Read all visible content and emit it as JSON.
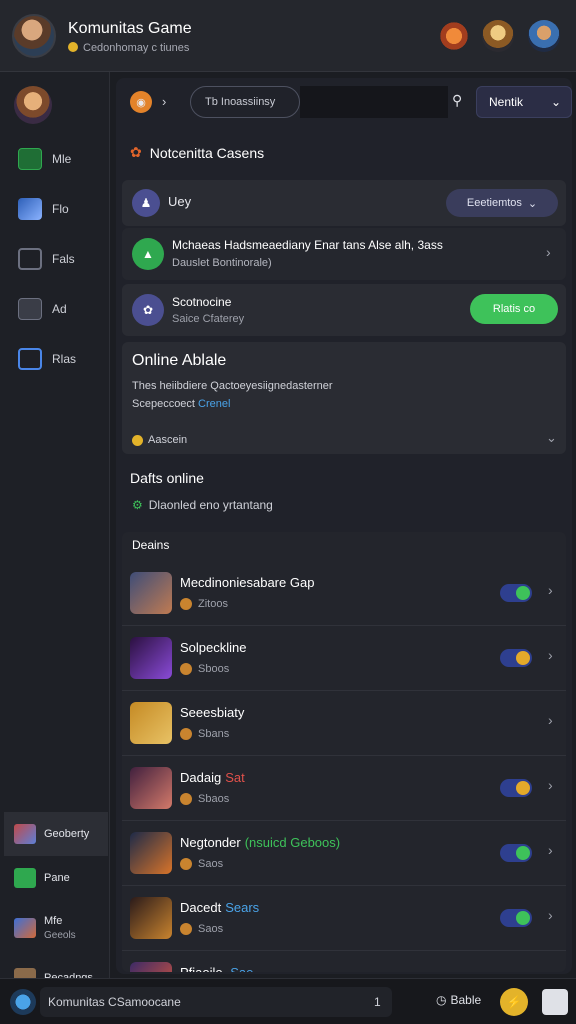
{
  "header": {
    "title": "Komunitas Game",
    "subtitle": "Cedonhomay c tiunes"
  },
  "sidebar": {
    "items": [
      {
        "label": "Mle",
        "color": "#2fa84f"
      },
      {
        "label": "Flo",
        "color": "#3d6fd6"
      },
      {
        "label": "Fals",
        "color": "#6c7080"
      },
      {
        "label": "Ad",
        "color": "#6c7080"
      },
      {
        "label": "Rlas",
        "color": "#4a86e8"
      }
    ],
    "bottom": [
      {
        "label": "Geoberty"
      },
      {
        "label": "Pane"
      },
      {
        "label": "Mfe",
        "sub": "Geeols"
      },
      {
        "label": "Pecadngs"
      }
    ]
  },
  "toolbar": {
    "path_label": "Tb Inoassiinsy",
    "filter_label": "Nentik"
  },
  "notifications": {
    "title": "Notcenitta Casens"
  },
  "cards": {
    "user": {
      "label": "Uey",
      "badge": "Eeetiemtos"
    },
    "banner": {
      "title": "Mchaeas Hadsmeaediany Enar tans Alse alh, 3ass",
      "subtitle": "Dauslet Bontinorale)"
    },
    "session": {
      "title": "Scotnocine",
      "subtitle": "Saice Cfaterey",
      "button": "Rlatis co"
    },
    "online": {
      "title": "Online Ablale",
      "desc": "Thes heiibdiere  Qactoeyesiignedasterner",
      "desc2": "Scepeccoect",
      "link": "Crenel",
      "footer": "Aascein"
    }
  },
  "friends_online": {
    "title": "Dafts online",
    "status": "Dlaonled eno yrtantang"
  },
  "games": {
    "title": "Deains",
    "rows": [
      {
        "name": "Mecdinoniesabare Gap",
        "status": "Zitoos",
        "tag": "",
        "tag_color": "",
        "toggle": true,
        "knob": "#3ec25a",
        "thumb": [
          "#3e4d78",
          "#c07b52"
        ]
      },
      {
        "name": "Solpeckline",
        "status": "Sboos",
        "tag": "",
        "tag_color": "",
        "toggle": true,
        "knob": "#e3a92a",
        "thumb": [
          "#2b1040",
          "#8a4bd8"
        ]
      },
      {
        "name": "Seeesbiaty",
        "status": "Sbans",
        "tag": "",
        "tag_color": "",
        "toggle": false,
        "knob": "",
        "thumb": [
          "#c58a24",
          "#e8c265"
        ]
      },
      {
        "name": "Dadaig",
        "status": "Sbaos",
        "tag": "Sat",
        "tag_color": "#e0514b",
        "toggle": true,
        "knob": "#e3a92a",
        "thumb": [
          "#41203e",
          "#d47a6a"
        ]
      },
      {
        "name": "Negtonder",
        "status": "Saos",
        "tag": "(nsuicd Geboos)",
        "tag_color": "#3ec25a",
        "toggle": true,
        "knob": "#3ec25a",
        "thumb": [
          "#1d2a48",
          "#d8742a"
        ]
      },
      {
        "name": "Dacedt",
        "status": "Saos",
        "tag": "Sears",
        "tag_color": "#4aa3e8",
        "toggle": true,
        "knob": "#3ec25a",
        "thumb": [
          "#2a1a1a",
          "#c9842f"
        ]
      },
      {
        "name": "Pfiaoilo.",
        "status": "",
        "tag": "Sae",
        "tag_color": "#4aa3e8",
        "toggle": true,
        "knob": "#3ec25a",
        "thumb": [
          "#3c2a66",
          "#e25a3a"
        ]
      }
    ]
  },
  "bottombar": {
    "input_text": "Komunitas CSamoocane",
    "count": "1",
    "action": "Bable"
  }
}
